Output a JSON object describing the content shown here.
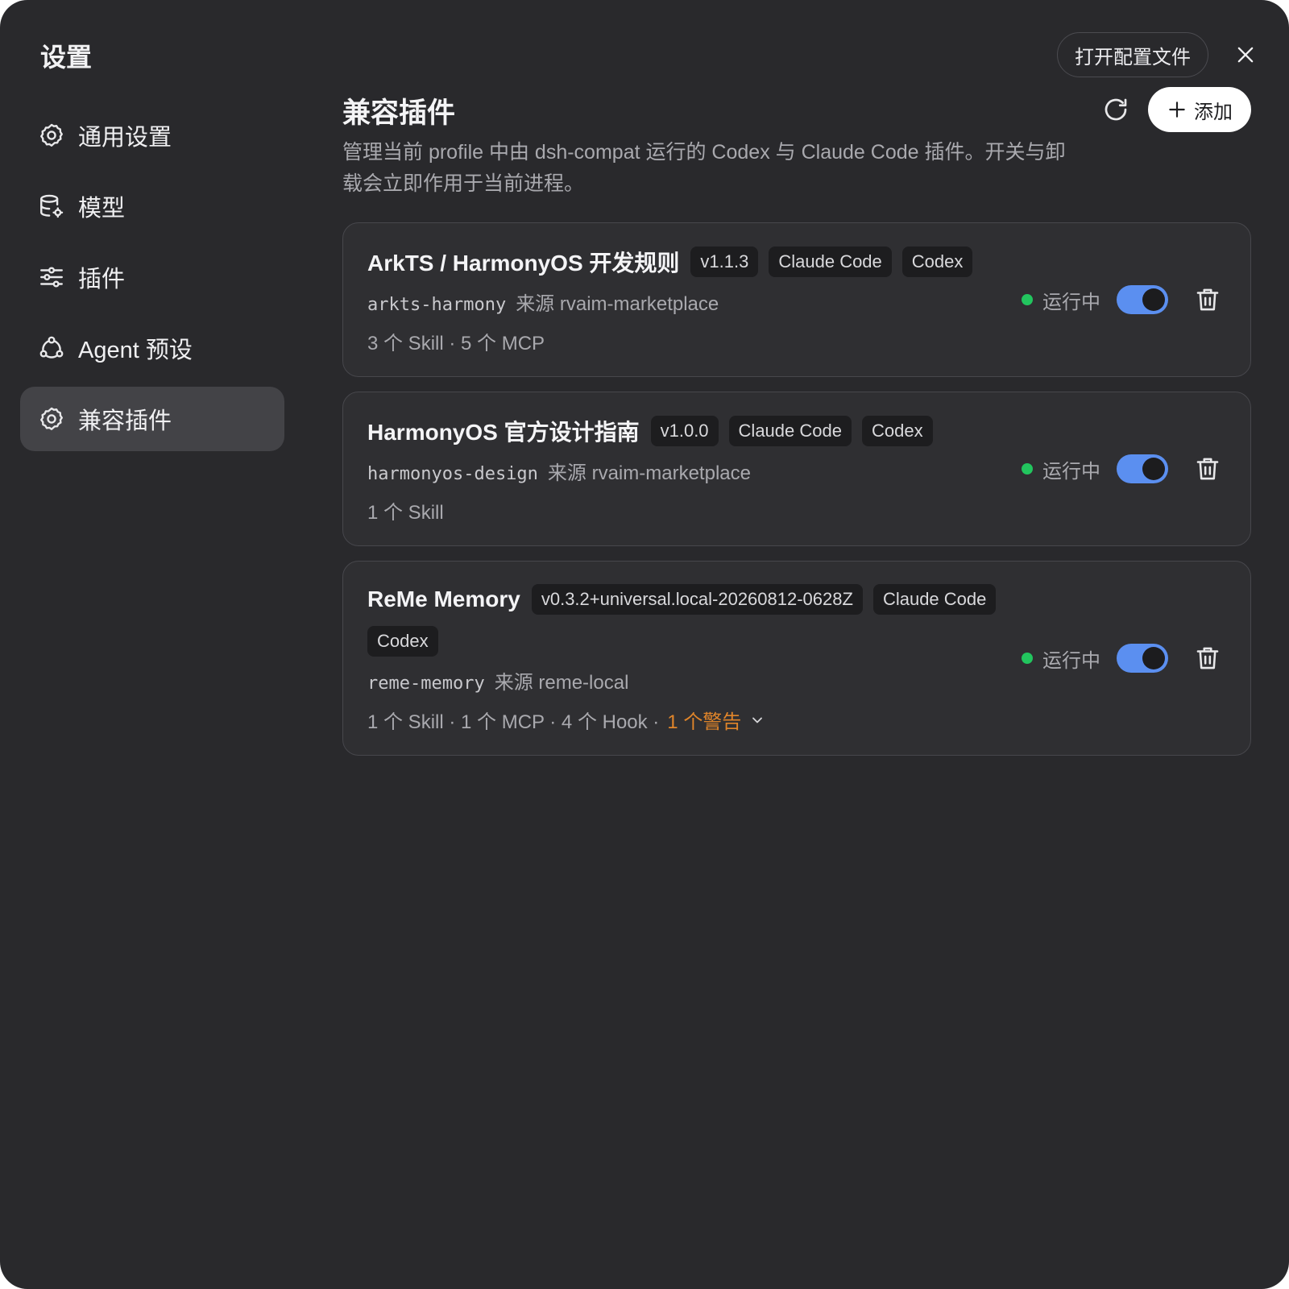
{
  "window": {
    "title": "设置",
    "open_config_label": "打开配置文件"
  },
  "sidebar": {
    "items": [
      {
        "label": "通用设置",
        "icon": "gear-icon"
      },
      {
        "label": "模型",
        "icon": "database-gear-icon"
      },
      {
        "label": "插件",
        "icon": "sliders-icon"
      },
      {
        "label": "Agent 预设",
        "icon": "agent-network-icon"
      },
      {
        "label": "兼容插件",
        "icon": "gear-icon",
        "active": true
      }
    ]
  },
  "main": {
    "title": "兼容插件",
    "add_label": "添加",
    "description": "管理当前 profile 中由 dsh-compat 运行的 Codex 与 Claude Code 插件。开关与卸载会立即作用于当前进程。"
  },
  "plugins": [
    {
      "name": "ArkTS / HarmonyOS 开发规则",
      "version": "v1.1.3",
      "tags": [
        "Claude Code",
        "Codex"
      ],
      "id": "arkts-harmony",
      "source": "来源 rvaim-marketplace",
      "stats": "3 个 Skill · 5 个 MCP",
      "status": "运行中",
      "enabled": true
    },
    {
      "name": "HarmonyOS 官方设计指南",
      "version": "v1.0.0",
      "tags": [
        "Claude Code",
        "Codex"
      ],
      "id": "harmonyos-design",
      "source": "来源 rvaim-marketplace",
      "stats": "1 个 Skill",
      "status": "运行中",
      "enabled": true
    },
    {
      "name": "ReMe Memory",
      "version": "v0.3.2+universal.local-20260812-0628Z",
      "tags": [
        "Claude Code",
        "Codex"
      ],
      "id": "reme-memory",
      "source": "来源 reme-local",
      "stats": "1 个 Skill · 1 个 MCP · 4 个 Hook ·",
      "warning": "1 个警告",
      "status": "运行中",
      "enabled": true
    }
  ],
  "colors": {
    "background": "#29292c",
    "card": "#2f2f32",
    "accent_toggle": "#5b8ff0",
    "status_green": "#22c55e",
    "warning_orange": "#e0852a"
  }
}
